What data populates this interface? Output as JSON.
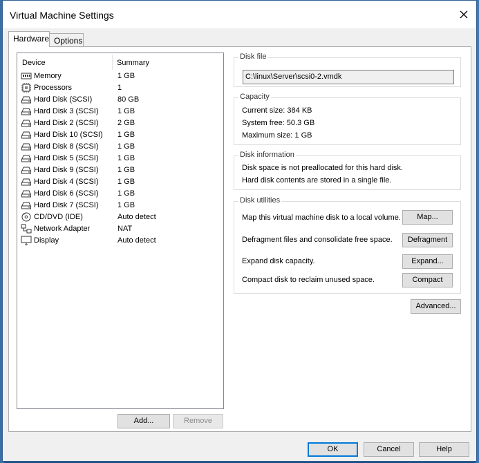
{
  "window": {
    "title": "Virtual Machine Settings"
  },
  "tabs": [
    {
      "label": "Hardware"
    },
    {
      "label": "Options"
    }
  ],
  "device_list": {
    "columns": [
      "Device",
      "Summary"
    ],
    "rows": [
      {
        "icon": "memory-icon",
        "device": "Memory",
        "summary": "1 GB"
      },
      {
        "icon": "processor-icon",
        "device": "Processors",
        "summary": "1"
      },
      {
        "icon": "hard-disk-icon",
        "device": "Hard Disk (SCSI)",
        "summary": "80 GB"
      },
      {
        "icon": "hard-disk-icon",
        "device": "Hard Disk 3 (SCSI)",
        "summary": "1 GB"
      },
      {
        "icon": "hard-disk-icon",
        "device": "Hard Disk 2 (SCSI)",
        "summary": "2 GB"
      },
      {
        "icon": "hard-disk-icon",
        "device": "Hard Disk 10 (SCSI)",
        "summary": "1 GB"
      },
      {
        "icon": "hard-disk-icon",
        "device": "Hard Disk 8 (SCSI)",
        "summary": "1 GB"
      },
      {
        "icon": "hard-disk-icon",
        "device": "Hard Disk 5 (SCSI)",
        "summary": "1 GB"
      },
      {
        "icon": "hard-disk-icon",
        "device": "Hard Disk 9 (SCSI)",
        "summary": "1 GB"
      },
      {
        "icon": "hard-disk-icon",
        "device": "Hard Disk 4 (SCSI)",
        "summary": "1 GB"
      },
      {
        "icon": "hard-disk-icon",
        "device": "Hard Disk 6 (SCSI)",
        "summary": "1 GB"
      },
      {
        "icon": "hard-disk-icon",
        "device": "Hard Disk 7 (SCSI)",
        "summary": "1 GB"
      },
      {
        "icon": "cd-dvd-icon",
        "device": "CD/DVD (IDE)",
        "summary": "Auto detect"
      },
      {
        "icon": "network-adapter-icon",
        "device": "Network Adapter",
        "summary": "NAT"
      },
      {
        "icon": "display-icon",
        "device": "Display",
        "summary": "Auto detect"
      }
    ]
  },
  "list_buttons": {
    "add": "Add...",
    "remove": "Remove"
  },
  "disk_file": {
    "title": "Disk file",
    "path": "C:\\linux\\Server\\scsi0-2.vmdk"
  },
  "capacity": {
    "title": "Capacity",
    "current_size": "Current size: 384 KB",
    "system_free": "System free: 50.3 GB",
    "maximum_size": "Maximum size: 1 GB"
  },
  "disk_information": {
    "title": "Disk information",
    "line1": "Disk space is not preallocated for this hard disk.",
    "line2": "Hard disk contents are stored in a single file."
  },
  "disk_utilities": {
    "title": "Disk utilities",
    "map_text": "Map this virtual machine disk to a local volume.",
    "map_button": "Map...",
    "defrag_text": "Defragment files and consolidate free space.",
    "defrag_button": "Defragment",
    "expand_text": "Expand disk capacity.",
    "expand_button": "Expand...",
    "compact_text": "Compact disk to reclaim unused space.",
    "compact_button": "Compact"
  },
  "advanced_button": "Advanced...",
  "footer": {
    "ok": "OK",
    "cancel": "Cancel",
    "help": "Help"
  }
}
